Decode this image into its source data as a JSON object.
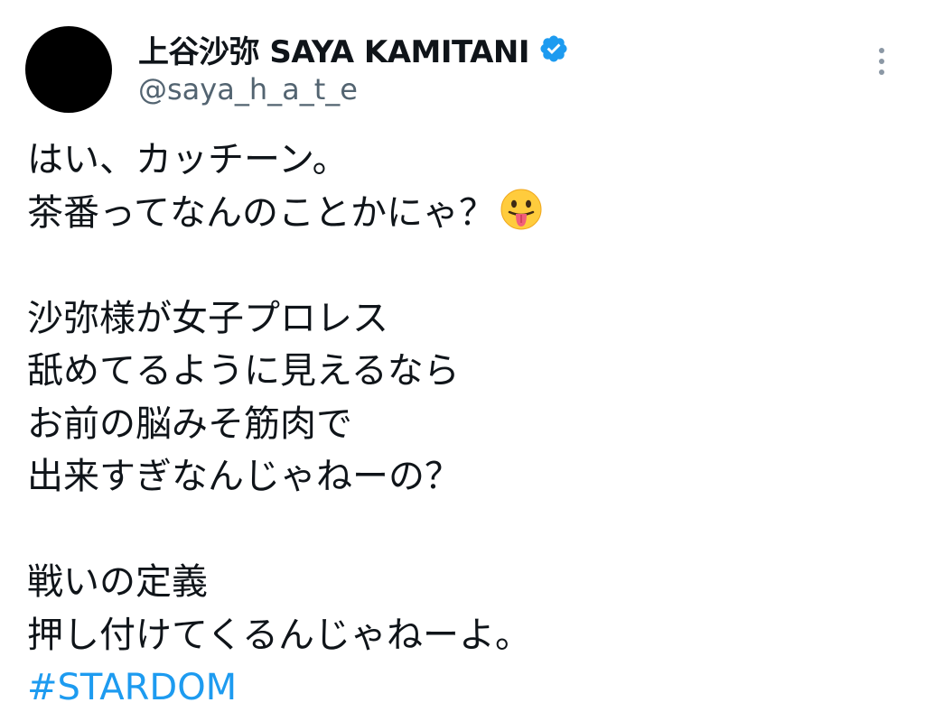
{
  "author": {
    "display_name": "上谷沙弥 SAYA KAMITANI",
    "handle": "@saya_h_a_t_e",
    "verified": true,
    "avatar_color": "#000000",
    "verified_color": "#1d9bf0"
  },
  "menu": {
    "icon": "more-vertical-icon"
  },
  "tweet": {
    "lines": [
      "はい、カッチーン。",
      "茶番ってなんのことかにゃ？",
      "",
      "沙弥様が女子プロレス",
      "舐めてるように見えるなら",
      "お前の脳みそ筋肉で",
      "出来すぎなんじゃねーの？",
      "",
      "戦いの定義",
      "押し付けてくるんじゃねーよ。"
    ],
    "emoji": "tongue-out-face-emoji",
    "hashtag": "#STARDOM",
    "hashtag_color": "#1d9bf0"
  }
}
